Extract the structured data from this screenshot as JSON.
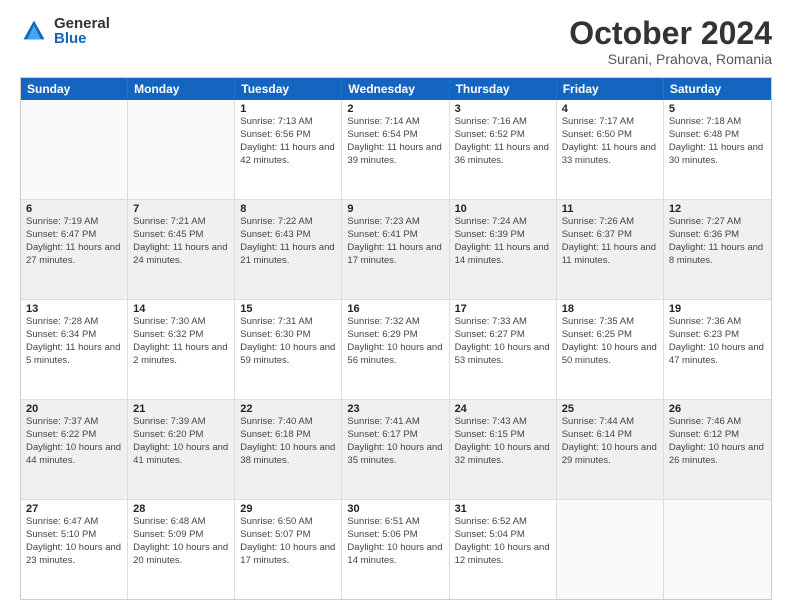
{
  "logo": {
    "general": "General",
    "blue": "Blue"
  },
  "title": "October 2024",
  "subtitle": "Surani, Prahova, Romania",
  "days": [
    "Sunday",
    "Monday",
    "Tuesday",
    "Wednesday",
    "Thursday",
    "Friday",
    "Saturday"
  ],
  "rows": [
    [
      {
        "day": "",
        "info": "",
        "empty": true
      },
      {
        "day": "",
        "info": "",
        "empty": true
      },
      {
        "day": "1",
        "info": "Sunrise: 7:13 AM\nSunset: 6:56 PM\nDaylight: 11 hours and 42 minutes.",
        "empty": false
      },
      {
        "day": "2",
        "info": "Sunrise: 7:14 AM\nSunset: 6:54 PM\nDaylight: 11 hours and 39 minutes.",
        "empty": false
      },
      {
        "day": "3",
        "info": "Sunrise: 7:16 AM\nSunset: 6:52 PM\nDaylight: 11 hours and 36 minutes.",
        "empty": false
      },
      {
        "day": "4",
        "info": "Sunrise: 7:17 AM\nSunset: 6:50 PM\nDaylight: 11 hours and 33 minutes.",
        "empty": false
      },
      {
        "day": "5",
        "info": "Sunrise: 7:18 AM\nSunset: 6:48 PM\nDaylight: 11 hours and 30 minutes.",
        "empty": false
      }
    ],
    [
      {
        "day": "6",
        "info": "Sunrise: 7:19 AM\nSunset: 6:47 PM\nDaylight: 11 hours and 27 minutes.",
        "empty": false,
        "shaded": true
      },
      {
        "day": "7",
        "info": "Sunrise: 7:21 AM\nSunset: 6:45 PM\nDaylight: 11 hours and 24 minutes.",
        "empty": false,
        "shaded": true
      },
      {
        "day": "8",
        "info": "Sunrise: 7:22 AM\nSunset: 6:43 PM\nDaylight: 11 hours and 21 minutes.",
        "empty": false,
        "shaded": true
      },
      {
        "day": "9",
        "info": "Sunrise: 7:23 AM\nSunset: 6:41 PM\nDaylight: 11 hours and 17 minutes.",
        "empty": false,
        "shaded": true
      },
      {
        "day": "10",
        "info": "Sunrise: 7:24 AM\nSunset: 6:39 PM\nDaylight: 11 hours and 14 minutes.",
        "empty": false,
        "shaded": true
      },
      {
        "day": "11",
        "info": "Sunrise: 7:26 AM\nSunset: 6:37 PM\nDaylight: 11 hours and 11 minutes.",
        "empty": false,
        "shaded": true
      },
      {
        "day": "12",
        "info": "Sunrise: 7:27 AM\nSunset: 6:36 PM\nDaylight: 11 hours and 8 minutes.",
        "empty": false,
        "shaded": true
      }
    ],
    [
      {
        "day": "13",
        "info": "Sunrise: 7:28 AM\nSunset: 6:34 PM\nDaylight: 11 hours and 5 minutes.",
        "empty": false
      },
      {
        "day": "14",
        "info": "Sunrise: 7:30 AM\nSunset: 6:32 PM\nDaylight: 11 hours and 2 minutes.",
        "empty": false
      },
      {
        "day": "15",
        "info": "Sunrise: 7:31 AM\nSunset: 6:30 PM\nDaylight: 10 hours and 59 minutes.",
        "empty": false
      },
      {
        "day": "16",
        "info": "Sunrise: 7:32 AM\nSunset: 6:29 PM\nDaylight: 10 hours and 56 minutes.",
        "empty": false
      },
      {
        "day": "17",
        "info": "Sunrise: 7:33 AM\nSunset: 6:27 PM\nDaylight: 10 hours and 53 minutes.",
        "empty": false
      },
      {
        "day": "18",
        "info": "Sunrise: 7:35 AM\nSunset: 6:25 PM\nDaylight: 10 hours and 50 minutes.",
        "empty": false
      },
      {
        "day": "19",
        "info": "Sunrise: 7:36 AM\nSunset: 6:23 PM\nDaylight: 10 hours and 47 minutes.",
        "empty": false
      }
    ],
    [
      {
        "day": "20",
        "info": "Sunrise: 7:37 AM\nSunset: 6:22 PM\nDaylight: 10 hours and 44 minutes.",
        "empty": false,
        "shaded": true
      },
      {
        "day": "21",
        "info": "Sunrise: 7:39 AM\nSunset: 6:20 PM\nDaylight: 10 hours and 41 minutes.",
        "empty": false,
        "shaded": true
      },
      {
        "day": "22",
        "info": "Sunrise: 7:40 AM\nSunset: 6:18 PM\nDaylight: 10 hours and 38 minutes.",
        "empty": false,
        "shaded": true
      },
      {
        "day": "23",
        "info": "Sunrise: 7:41 AM\nSunset: 6:17 PM\nDaylight: 10 hours and 35 minutes.",
        "empty": false,
        "shaded": true
      },
      {
        "day": "24",
        "info": "Sunrise: 7:43 AM\nSunset: 6:15 PM\nDaylight: 10 hours and 32 minutes.",
        "empty": false,
        "shaded": true
      },
      {
        "day": "25",
        "info": "Sunrise: 7:44 AM\nSunset: 6:14 PM\nDaylight: 10 hours and 29 minutes.",
        "empty": false,
        "shaded": true
      },
      {
        "day": "26",
        "info": "Sunrise: 7:46 AM\nSunset: 6:12 PM\nDaylight: 10 hours and 26 minutes.",
        "empty": false,
        "shaded": true
      }
    ],
    [
      {
        "day": "27",
        "info": "Sunrise: 6:47 AM\nSunset: 5:10 PM\nDaylight: 10 hours and 23 minutes.",
        "empty": false
      },
      {
        "day": "28",
        "info": "Sunrise: 6:48 AM\nSunset: 5:09 PM\nDaylight: 10 hours and 20 minutes.",
        "empty": false
      },
      {
        "day": "29",
        "info": "Sunrise: 6:50 AM\nSunset: 5:07 PM\nDaylight: 10 hours and 17 minutes.",
        "empty": false
      },
      {
        "day": "30",
        "info": "Sunrise: 6:51 AM\nSunset: 5:06 PM\nDaylight: 10 hours and 14 minutes.",
        "empty": false
      },
      {
        "day": "31",
        "info": "Sunrise: 6:52 AM\nSunset: 5:04 PM\nDaylight: 10 hours and 12 minutes.",
        "empty": false
      },
      {
        "day": "",
        "info": "",
        "empty": true
      },
      {
        "day": "",
        "info": "",
        "empty": true
      }
    ]
  ]
}
